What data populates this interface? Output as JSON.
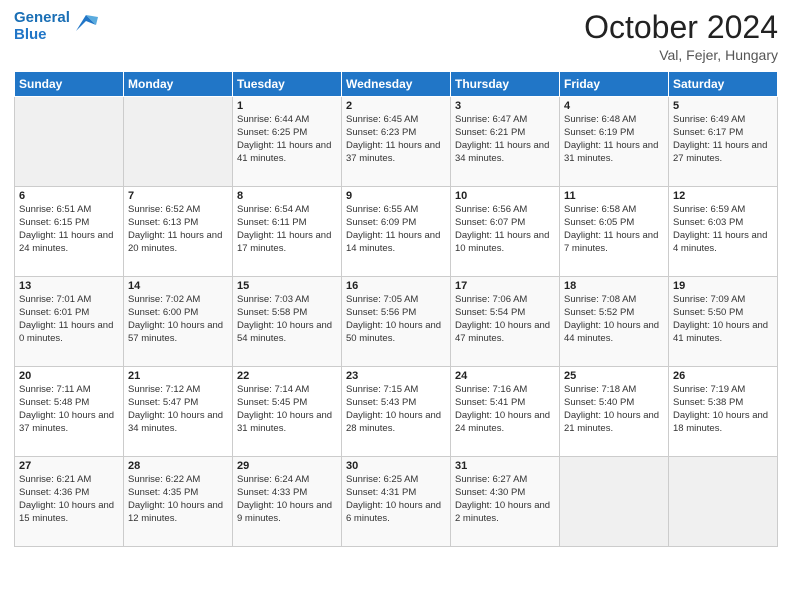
{
  "header": {
    "logo_line1": "General",
    "logo_line2": "Blue",
    "month": "October 2024",
    "location": "Val, Fejer, Hungary"
  },
  "days_of_week": [
    "Sunday",
    "Monday",
    "Tuesday",
    "Wednesday",
    "Thursday",
    "Friday",
    "Saturday"
  ],
  "weeks": [
    [
      {
        "day": "",
        "sunrise": "",
        "sunset": "",
        "daylight": ""
      },
      {
        "day": "",
        "sunrise": "",
        "sunset": "",
        "daylight": ""
      },
      {
        "day": "1",
        "sunrise": "Sunrise: 6:44 AM",
        "sunset": "Sunset: 6:25 PM",
        "daylight": "Daylight: 11 hours and 41 minutes."
      },
      {
        "day": "2",
        "sunrise": "Sunrise: 6:45 AM",
        "sunset": "Sunset: 6:23 PM",
        "daylight": "Daylight: 11 hours and 37 minutes."
      },
      {
        "day": "3",
        "sunrise": "Sunrise: 6:47 AM",
        "sunset": "Sunset: 6:21 PM",
        "daylight": "Daylight: 11 hours and 34 minutes."
      },
      {
        "day": "4",
        "sunrise": "Sunrise: 6:48 AM",
        "sunset": "Sunset: 6:19 PM",
        "daylight": "Daylight: 11 hours and 31 minutes."
      },
      {
        "day": "5",
        "sunrise": "Sunrise: 6:49 AM",
        "sunset": "Sunset: 6:17 PM",
        "daylight": "Daylight: 11 hours and 27 minutes."
      }
    ],
    [
      {
        "day": "6",
        "sunrise": "Sunrise: 6:51 AM",
        "sunset": "Sunset: 6:15 PM",
        "daylight": "Daylight: 11 hours and 24 minutes."
      },
      {
        "day": "7",
        "sunrise": "Sunrise: 6:52 AM",
        "sunset": "Sunset: 6:13 PM",
        "daylight": "Daylight: 11 hours and 20 minutes."
      },
      {
        "day": "8",
        "sunrise": "Sunrise: 6:54 AM",
        "sunset": "Sunset: 6:11 PM",
        "daylight": "Daylight: 11 hours and 17 minutes."
      },
      {
        "day": "9",
        "sunrise": "Sunrise: 6:55 AM",
        "sunset": "Sunset: 6:09 PM",
        "daylight": "Daylight: 11 hours and 14 minutes."
      },
      {
        "day": "10",
        "sunrise": "Sunrise: 6:56 AM",
        "sunset": "Sunset: 6:07 PM",
        "daylight": "Daylight: 11 hours and 10 minutes."
      },
      {
        "day": "11",
        "sunrise": "Sunrise: 6:58 AM",
        "sunset": "Sunset: 6:05 PM",
        "daylight": "Daylight: 11 hours and 7 minutes."
      },
      {
        "day": "12",
        "sunrise": "Sunrise: 6:59 AM",
        "sunset": "Sunset: 6:03 PM",
        "daylight": "Daylight: 11 hours and 4 minutes."
      }
    ],
    [
      {
        "day": "13",
        "sunrise": "Sunrise: 7:01 AM",
        "sunset": "Sunset: 6:01 PM",
        "daylight": "Daylight: 11 hours and 0 minutes."
      },
      {
        "day": "14",
        "sunrise": "Sunrise: 7:02 AM",
        "sunset": "Sunset: 6:00 PM",
        "daylight": "Daylight: 10 hours and 57 minutes."
      },
      {
        "day": "15",
        "sunrise": "Sunrise: 7:03 AM",
        "sunset": "Sunset: 5:58 PM",
        "daylight": "Daylight: 10 hours and 54 minutes."
      },
      {
        "day": "16",
        "sunrise": "Sunrise: 7:05 AM",
        "sunset": "Sunset: 5:56 PM",
        "daylight": "Daylight: 10 hours and 50 minutes."
      },
      {
        "day": "17",
        "sunrise": "Sunrise: 7:06 AM",
        "sunset": "Sunset: 5:54 PM",
        "daylight": "Daylight: 10 hours and 47 minutes."
      },
      {
        "day": "18",
        "sunrise": "Sunrise: 7:08 AM",
        "sunset": "Sunset: 5:52 PM",
        "daylight": "Daylight: 10 hours and 44 minutes."
      },
      {
        "day": "19",
        "sunrise": "Sunrise: 7:09 AM",
        "sunset": "Sunset: 5:50 PM",
        "daylight": "Daylight: 10 hours and 41 minutes."
      }
    ],
    [
      {
        "day": "20",
        "sunrise": "Sunrise: 7:11 AM",
        "sunset": "Sunset: 5:48 PM",
        "daylight": "Daylight: 10 hours and 37 minutes."
      },
      {
        "day": "21",
        "sunrise": "Sunrise: 7:12 AM",
        "sunset": "Sunset: 5:47 PM",
        "daylight": "Daylight: 10 hours and 34 minutes."
      },
      {
        "day": "22",
        "sunrise": "Sunrise: 7:14 AM",
        "sunset": "Sunset: 5:45 PM",
        "daylight": "Daylight: 10 hours and 31 minutes."
      },
      {
        "day": "23",
        "sunrise": "Sunrise: 7:15 AM",
        "sunset": "Sunset: 5:43 PM",
        "daylight": "Daylight: 10 hours and 28 minutes."
      },
      {
        "day": "24",
        "sunrise": "Sunrise: 7:16 AM",
        "sunset": "Sunset: 5:41 PM",
        "daylight": "Daylight: 10 hours and 24 minutes."
      },
      {
        "day": "25",
        "sunrise": "Sunrise: 7:18 AM",
        "sunset": "Sunset: 5:40 PM",
        "daylight": "Daylight: 10 hours and 21 minutes."
      },
      {
        "day": "26",
        "sunrise": "Sunrise: 7:19 AM",
        "sunset": "Sunset: 5:38 PM",
        "daylight": "Daylight: 10 hours and 18 minutes."
      }
    ],
    [
      {
        "day": "27",
        "sunrise": "Sunrise: 6:21 AM",
        "sunset": "Sunset: 4:36 PM",
        "daylight": "Daylight: 10 hours and 15 minutes."
      },
      {
        "day": "28",
        "sunrise": "Sunrise: 6:22 AM",
        "sunset": "Sunset: 4:35 PM",
        "daylight": "Daylight: 10 hours and 12 minutes."
      },
      {
        "day": "29",
        "sunrise": "Sunrise: 6:24 AM",
        "sunset": "Sunset: 4:33 PM",
        "daylight": "Daylight: 10 hours and 9 minutes."
      },
      {
        "day": "30",
        "sunrise": "Sunrise: 6:25 AM",
        "sunset": "Sunset: 4:31 PM",
        "daylight": "Daylight: 10 hours and 6 minutes."
      },
      {
        "day": "31",
        "sunrise": "Sunrise: 6:27 AM",
        "sunset": "Sunset: 4:30 PM",
        "daylight": "Daylight: 10 hours and 2 minutes."
      },
      {
        "day": "",
        "sunrise": "",
        "sunset": "",
        "daylight": ""
      },
      {
        "day": "",
        "sunrise": "",
        "sunset": "",
        "daylight": ""
      }
    ]
  ]
}
